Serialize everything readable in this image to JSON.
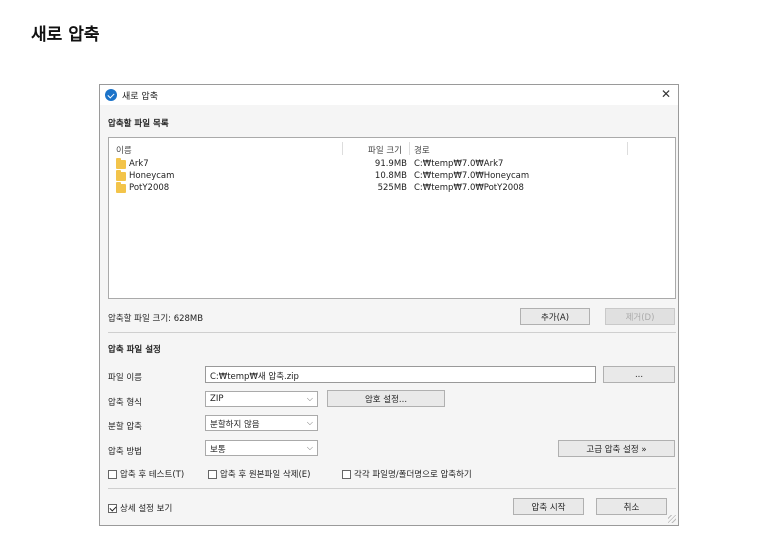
{
  "page_heading": "새로 압축",
  "dialog": {
    "title": "새로 압축",
    "section_file_list": "압축할 파일 목록",
    "columns": {
      "name": "이름",
      "size": "파일 크기",
      "path": "경로"
    },
    "files": [
      {
        "name": "Ark7",
        "size": "91.9MB",
        "path": "C:₩temp₩7.0₩Ark7"
      },
      {
        "name": "Honeycam",
        "size": "10.8MB",
        "path": "C:₩temp₩7.0₩Honeycam"
      },
      {
        "name": "PotY2008",
        "size": "525MB",
        "path": "C:₩temp₩7.0₩PotY2008"
      }
    ],
    "total_size": "압축할 파일 크기: 628MB",
    "add_button": "추가(A)",
    "remove_button": "제거(D)",
    "section_settings": "압축 파일 설정",
    "file_name_label": "파일 이름",
    "file_name_value": "C:₩temp₩새 압축.zip",
    "browse_button": "...",
    "format_label": "압축 형식",
    "format_value": "ZIP",
    "password_button": "암호 설정...",
    "split_label": "분할 압축",
    "split_value": "분할하지 않음",
    "method_label": "압축 방법",
    "method_value": "보통",
    "advanced_button": "고급 압축 설정 »",
    "check_test": "압축 후 테스트(T)",
    "check_delete": "압축 후 원본파일 삭제(E)",
    "check_each": "각각 파일명/폴더명으로 압축하기",
    "check_details": "상세 설정 보기",
    "start_button": "압축 시작",
    "cancel_button": "취소"
  }
}
